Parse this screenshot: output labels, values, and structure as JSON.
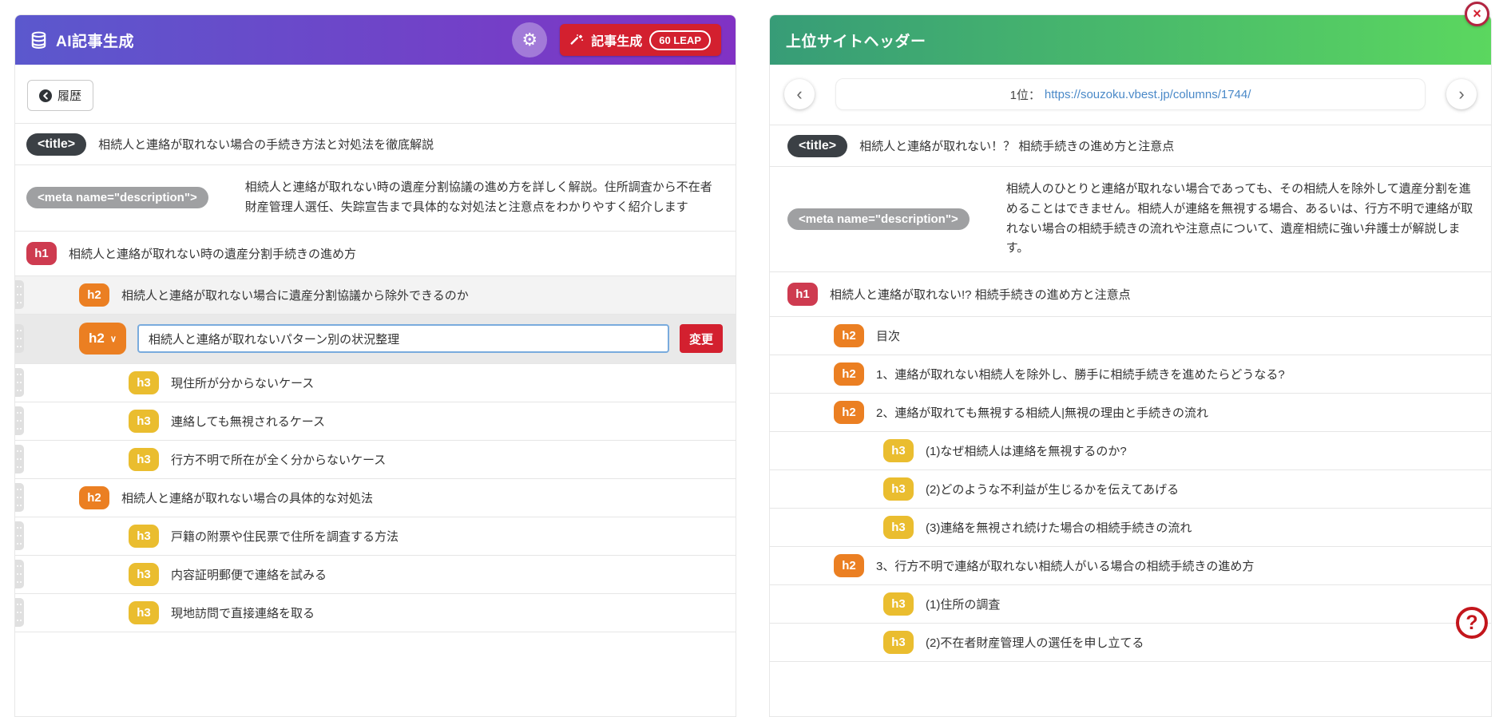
{
  "colors": {
    "header_left_gradient": [
      "#5b58cd",
      "#8132c4"
    ],
    "header_right_gradient": [
      "#379c77",
      "#5bd75f"
    ],
    "h1_badge": "#ce3b50",
    "h2_badge": "#eb7f22",
    "h3_badge": "#eabd2f",
    "accent_red": "#d3202f",
    "link": "#4a89c8"
  },
  "icons": {
    "database": "database-icon",
    "gear": "⚙",
    "wand": "magic-wand-icon",
    "history_back": "circle-arrow-left-icon",
    "caret_down": "∨",
    "prev": "‹",
    "next": "›",
    "close": "×",
    "help": "?"
  },
  "left_panel": {
    "header": {
      "title": "AI記事生成",
      "generate_label": "記事生成",
      "generate_badge": "60 LEAP"
    },
    "history_label": "履歴",
    "title_row": {
      "tag": "<title>",
      "text": "相続人と連絡が取れない場合の手続き方法と対処法を徹底解説"
    },
    "meta_row": {
      "tag": "<meta name=\"description\">",
      "text": "相続人と連絡が取れない時の遺産分割協議の進め方を詳しく解説。住所調査から不在者財産管理人選任、失踪宣告まで具体的な対処法と注意点をわかりやすく紹介します"
    },
    "edit_row": {
      "tag": "h2",
      "value": "相続人と連絡が取れないパターン別の状況整理",
      "change_label": "変更"
    },
    "outline": [
      {
        "tag": "h1",
        "text": "相続人と連絡が取れない時の遺産分割手続きの進め方"
      },
      {
        "tag": "h2",
        "text": "相続人と連絡が取れない場合に遺産分割協議から除外できるのか"
      },
      {
        "tag": "h3",
        "text": "現住所が分からないケース"
      },
      {
        "tag": "h3",
        "text": "連絡しても無視されるケース"
      },
      {
        "tag": "h3",
        "text": "行方不明で所在が全く分からないケース"
      },
      {
        "tag": "h2",
        "text": "相続人と連絡が取れない場合の具体的な対処法"
      },
      {
        "tag": "h3",
        "text": "戸籍の附票や住民票で住所を調査する方法"
      },
      {
        "tag": "h3",
        "text": "内容証明郵便で連絡を試みる"
      },
      {
        "tag": "h3",
        "text": "現地訪問で直接連絡を取る"
      }
    ]
  },
  "right_panel": {
    "header": {
      "title": "上位サイトヘッダー"
    },
    "nav": {
      "rank_label": "1位：",
      "url": "https://souzoku.vbest.jp/columns/1744/"
    },
    "title_row": {
      "tag": "<title>",
      "text": "相続人と連絡が取れない！？ 相続手続きの進め方と注意点"
    },
    "meta_row": {
      "tag": "<meta name=\"description\">",
      "text": "相続人のひとりと連絡が取れない場合であっても、その相続人を除外して遺産分割を進めることはできません。相続人が連絡を無視する場合、あるいは、行方不明で連絡が取れない場合の相続手続きの流れや注意点について、遺産相続に強い弁護士が解説します。"
    },
    "outline": [
      {
        "tag": "h1",
        "text": "相続人と連絡が取れない!? 相続手続きの進め方と注意点"
      },
      {
        "tag": "h2",
        "text": "目次"
      },
      {
        "tag": "h2",
        "text": "1、連絡が取れない相続人を除外し、勝手に相続手続きを進めたらどうなる?"
      },
      {
        "tag": "h2",
        "text": "2、連絡が取れても無視する相続人|無視の理由と手続きの流れ"
      },
      {
        "tag": "h3",
        "text": "(1)なぜ相続人は連絡を無視するのか?"
      },
      {
        "tag": "h3",
        "text": "(2)どのような不利益が生じるかを伝えてあげる"
      },
      {
        "tag": "h3",
        "text": "(3)連絡を無視され続けた場合の相続手続きの流れ"
      },
      {
        "tag": "h2",
        "text": "3、行方不明で連絡が取れない相続人がいる場合の相続手続きの進め方"
      },
      {
        "tag": "h3",
        "text": "(1)住所の調査"
      },
      {
        "tag": "h3",
        "text": "(2)不在者財産管理人の選任を申し立てる"
      }
    ]
  }
}
